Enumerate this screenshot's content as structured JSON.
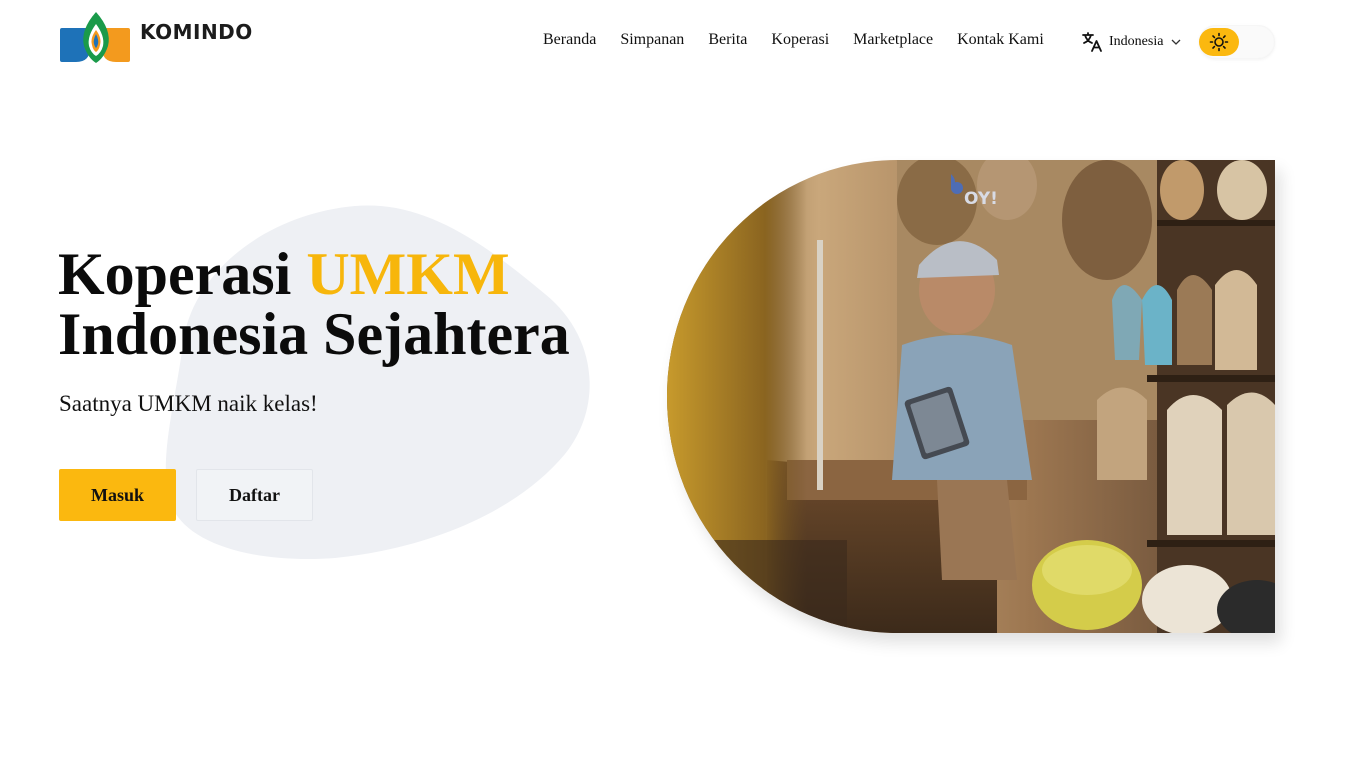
{
  "brand": {
    "name": "KOMINDO"
  },
  "nav": {
    "items": [
      {
        "label": "Beranda"
      },
      {
        "label": "Simpanan"
      },
      {
        "label": "Berita"
      },
      {
        "label": "Koperasi"
      },
      {
        "label": "Marketplace"
      },
      {
        "label": "Kontak Kami"
      }
    ]
  },
  "language": {
    "selected": "Indonesia",
    "icon": "translate-icon"
  },
  "theme": {
    "mode": "light",
    "icon": "sun-icon",
    "accent": "#fbb80f"
  },
  "hero": {
    "title_part1": "Koperasi",
    "title_accent": "UMKM",
    "title_line2": "Indonesia Sejahtera",
    "subtitle": "Saatnya UMKM naik kelas!",
    "login_label": "Masuk",
    "register_label": "Daftar",
    "image_sign": "OY!"
  },
  "colors": {
    "accent": "#f7b60b",
    "button_primary": "#fbb80f",
    "button_secondary": "#f1f3f6",
    "blob": "#eef0f4"
  }
}
